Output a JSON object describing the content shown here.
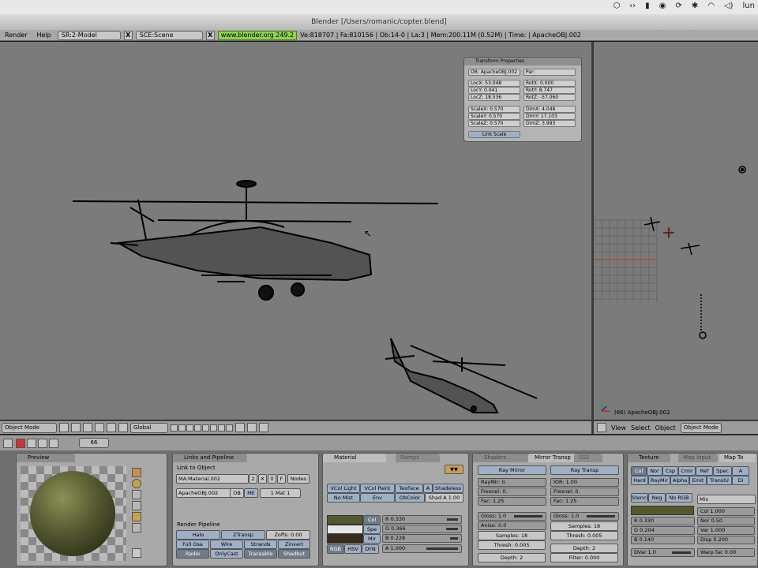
{
  "macbar": {
    "user": "lun"
  },
  "window": {
    "title": "Blender [/Users/romanic/copter.blend]"
  },
  "header": {
    "menus": [
      "Render",
      "Help"
    ],
    "screen": "SR:2-Model",
    "scene": "SCE:Scene",
    "url": "www.blender.org 249.2",
    "stats": "Ve:818707 | Fa:810156 | Ob:14-0 | La:3 | Mem:200.11M (0.52M) | Time: | ApacheOBJ.002"
  },
  "transform": {
    "title": "Transform Properties",
    "obname": "OB: ApacheOBJ.002",
    "par": "Par:",
    "loc": [
      "LocX: 53.048",
      "LocY: 0.041",
      "LocZ: 18.536"
    ],
    "rot": [
      "RotX: 0.000",
      "RotY: 8.747",
      "RotZ: -57.060"
    ],
    "scale": [
      "ScaleX: 0.570",
      "ScaleY: 0.570",
      "ScaleZ: 0.570"
    ],
    "dim": [
      "DimX: 4.048",
      "DimY: 17.103",
      "DimZ: 3.993"
    ],
    "link": "Link Scale"
  },
  "viewport2": {
    "label": "(66) ApacheOBJ.002"
  },
  "vheader1": {
    "mode": "Object Mode",
    "orient": "Global"
  },
  "vheader2": {
    "menus": [
      "View",
      "Select",
      "Object"
    ],
    "mode": "Object Mode"
  },
  "bwheader": {
    "frame": "66"
  },
  "preview": {
    "title": "Preview"
  },
  "links": {
    "title": "Links and Pipeline",
    "link_to": "Link to Object",
    "material": "MA:Material.002",
    "users": "2",
    "f": "F",
    "nodes": "Nodes",
    "object": "ApacheOBJ.002",
    "ob": "OB",
    "me": "ME",
    "mat_count": "1 Mat 1",
    "pipeline": "Render Pipeline",
    "buttons": [
      "Halo",
      "ZTransp",
      "Zoffs: 0.00",
      "Full Osa",
      "Wire",
      "Strands",
      "Zinvert",
      "Radio",
      "OnlyCast",
      "Traceable",
      "Shadbut"
    ]
  },
  "material": {
    "tabs": [
      "Material",
      "Ramps"
    ],
    "vcol": [
      "VCol Light",
      "VCol Paint",
      "TexFace",
      "A",
      "Shadeless",
      "No Mist",
      "Env",
      "ObColor",
      "Shad A 1.00"
    ],
    "colors": [
      "Col",
      "Spe",
      "Mir"
    ],
    "rgb": [
      "R 0.330",
      "G 0.366",
      "B 0.228"
    ],
    "modes": [
      "RGB",
      "HSV",
      "DYN"
    ],
    "alpha": "A 1.000"
  },
  "shaders": {
    "tabs": [
      "Shaders",
      "Mirror Transp",
      "SSS"
    ],
    "mirror": [
      "Ray Mirror",
      "RayMir: 0.",
      "Fresnel: 0.",
      "Fac: 1.25",
      "Gloss: 1.0",
      "Aniso: 0.0",
      "Samples: 18",
      "Thresh: 0.005",
      "Depth: 2"
    ],
    "transp": [
      "Ray Transp",
      "IOR: 1.00",
      "Fresnel: 0.",
      "Fac: 1.25",
      "Gloss: 1.0",
      "Samples: 18",
      "Thresh: 0.005",
      "Depth: 2",
      "Filter: 0.000"
    ]
  },
  "texture": {
    "tabs": [
      "Texture",
      "Map Input",
      "Map To"
    ],
    "row1": [
      "Col",
      "Nor",
      "Csp",
      "Cmir",
      "Ref",
      "Spec",
      "A"
    ],
    "row2": [
      "Hard",
      "RayMir",
      "Alpha",
      "Emit",
      "TranslU",
      "Di"
    ],
    "stencil": [
      "Stencil",
      "Neg",
      "No RGB"
    ],
    "blend": "Mix",
    "rgb": [
      "R 0.330",
      "G 0.204",
      "B 0.140"
    ],
    "right": [
      "Col 1.000",
      "Nor 0.50",
      "Var 1.000",
      "Disp 0.200"
    ],
    "dvar": "DVar 1.0",
    "warp": "Warp fac 0.00"
  },
  "colors": {
    "viewport_bg": "#7b7b7b",
    "panel_bg": "#a9a9a9",
    "material_col": "#54582f"
  }
}
